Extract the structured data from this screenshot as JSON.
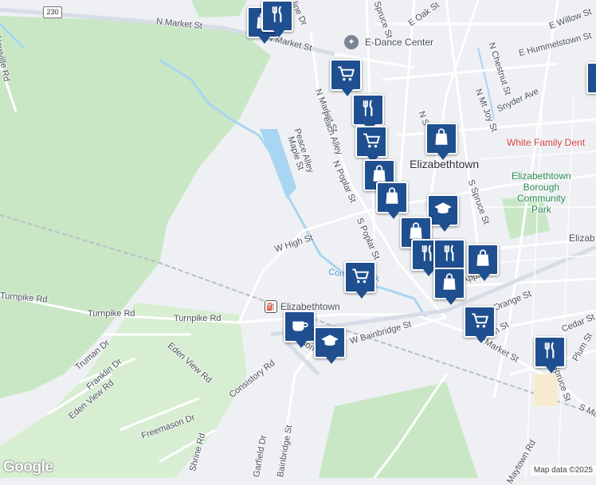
{
  "route_shield": "230",
  "roads": {
    "n_market": "N Market St",
    "n_market_b": "N Market St",
    "market_vert": "N Market St",
    "newville": "Newville Rd",
    "e_oak": "E Oak St",
    "spruce_top": "Spruce St",
    "line_dr": "line Dr",
    "e_willow": "E Willow St",
    "n_chestnut": "N Chestnut St",
    "e_hummelstown": "E Hummelstown St",
    "snyder": "Snyder Ave",
    "n_mt_joy": "N Mt Joy St",
    "peace_alley": "Peace Alley",
    "maple": "Maple St",
    "peach_alley": "Peach Alley",
    "n_poplar": "N Poplar St",
    "s_poplar": "S Poplar St",
    "w_high": "W High St",
    "s_spruce": "S Spruce St",
    "turnpike_left": "Turnpike Rd",
    "turnpike_mid": "Turnpike Rd",
    "eden_view": "Eden View Rd",
    "truman": "Truman Dr",
    "franklin": "Franklin Dr",
    "eden_view_2": "Eden View Rd",
    "consistory": "Consistory Rd",
    "masonic": "Masonic Dr",
    "w_bainbridge": "W Bainbridge St",
    "freemason": "Freemason Dr",
    "shrine": "Shrine Rd",
    "garfield": "Garfield Dr",
    "bainbridge_s": "Bainbridge St",
    "s_market": "S Market St",
    "arch": "Arch St",
    "orange": "Orange St",
    "cedar": "Cedar St",
    "plum": "Plum St",
    "spruce_s2": "Spruce St",
    "s_ma": "S Ma",
    "maytown": "Maytown Rd",
    "apple": "Apple",
    "n_s": "N S"
  },
  "places": {
    "dance": "E-Dance Center",
    "town": "Elizabethtown",
    "park": [
      "Elizabethtown",
      "Borough",
      "Community",
      "Park"
    ],
    "white_family": "White Family Dent",
    "eliza_right": "Elizab",
    "station": "Elizabethtown",
    "creek": "Conoy Creek"
  },
  "pins": [
    {
      "type": "shopping",
      "label": "shopping-bag-icon"
    },
    {
      "type": "restaurant",
      "label": "restaurant-icon"
    },
    {
      "type": "grocery",
      "label": "shopping-cart-icon"
    },
    {
      "type": "restaurant",
      "label": "restaurant-icon"
    },
    {
      "type": "shopping",
      "label": "shopping-bag-icon"
    },
    {
      "type": "grocery",
      "label": "shopping-cart-icon"
    },
    {
      "type": "shopping",
      "label": "shopping-bag-icon"
    },
    {
      "type": "shopping",
      "label": "shopping-bag-icon"
    },
    {
      "type": "school",
      "label": "school-icon"
    },
    {
      "type": "shopping",
      "label": "shopping-bag-icon"
    },
    {
      "type": "restaurant",
      "label": "restaurant-icon"
    },
    {
      "type": "restaurant",
      "label": "restaurant-icon"
    },
    {
      "type": "shopping",
      "label": "shopping-bag-icon"
    },
    {
      "type": "grocery",
      "label": "shopping-cart-icon"
    },
    {
      "type": "shopping",
      "label": "shopping-bag-icon"
    },
    {
      "type": "grocery",
      "label": "shopping-cart-icon"
    },
    {
      "type": "cafe",
      "label": "cafe-icon"
    },
    {
      "type": "school",
      "label": "school-icon"
    },
    {
      "type": "restaurant",
      "label": "restaurant-icon"
    },
    {
      "type": "shopping",
      "label": "shopping-bag-icon"
    }
  ],
  "branding": {
    "logo": "Google",
    "attribution": "Map data ©2025"
  },
  "colors": {
    "pin": "#1f4f8f",
    "park": "#c9e7c5",
    "water": "#a8d5f2",
    "road": "#ffffff",
    "major_road": "#d7dde6"
  }
}
